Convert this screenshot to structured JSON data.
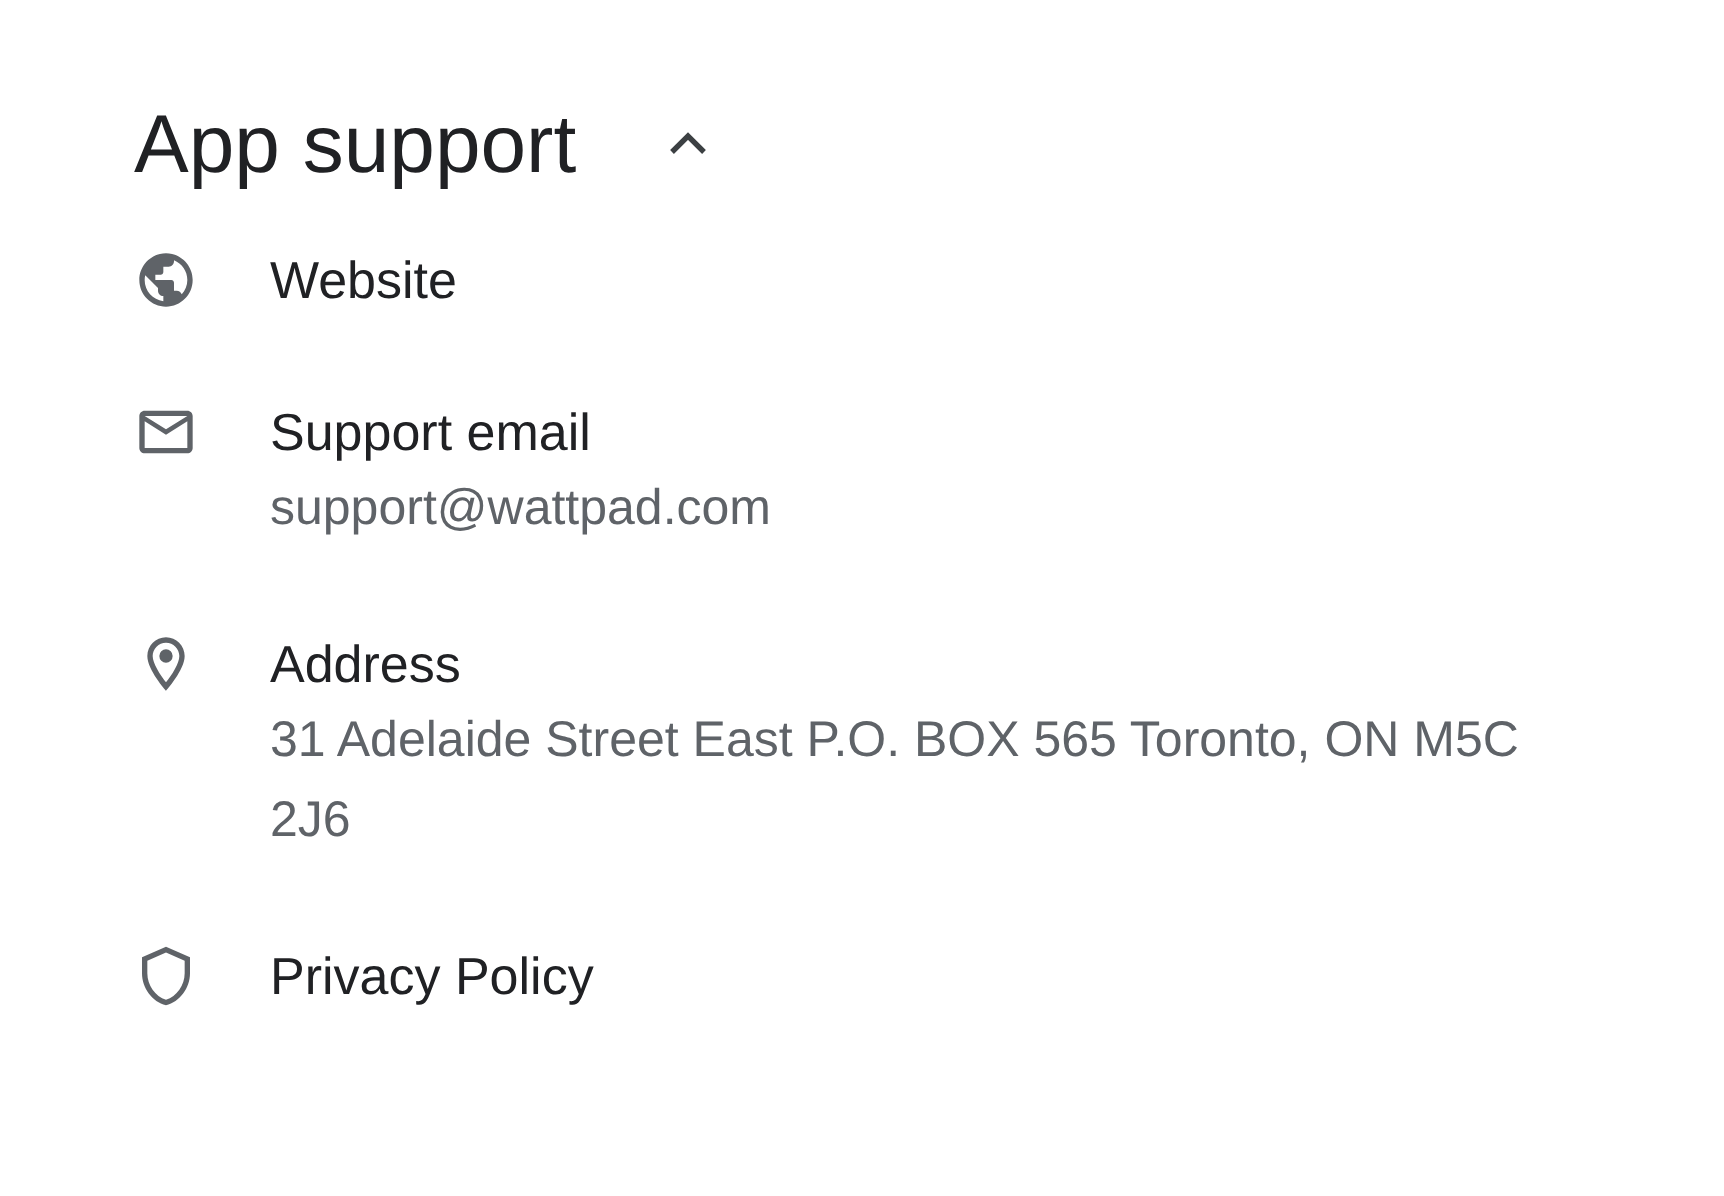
{
  "section": {
    "title": "App support",
    "expanded": true
  },
  "items": [
    {
      "kind": "website",
      "title": "Website"
    },
    {
      "kind": "email",
      "title": "Support email",
      "detail": "support@wattpad.com"
    },
    {
      "kind": "address",
      "title": "Address",
      "detail": "31 Adelaide Street East P.O. BOX 565 Toronto, ON M5C 2J6"
    },
    {
      "kind": "privacy",
      "title": "Privacy Policy"
    }
  ]
}
